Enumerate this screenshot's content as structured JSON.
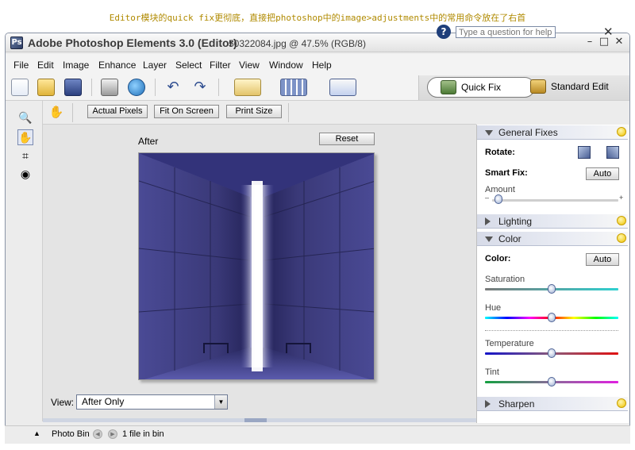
{
  "caption": "Editor模块的quick fix更彻底，直接把photoshop中的image>adjustments中的常用命令放在了右首",
  "window": {
    "title_app": "Adobe Photoshop Elements 3.0 (Editor)",
    "title_file": "50322084.jpg @ 47.5% (RGB/8)",
    "controls": [
      "–",
      "□",
      "✕"
    ]
  },
  "menu": {
    "items": [
      "File",
      "Edit",
      "Image",
      "Enhance",
      "Layer",
      "Select",
      "Filter",
      "View",
      "Window",
      "Help"
    ],
    "help_placeholder": "Type a question for help",
    "help_icon": "?",
    "close_doc": "✕"
  },
  "modes": {
    "quick_fix": "Quick Fix",
    "standard_edit": "Standard Edit"
  },
  "options_bar": {
    "actual_pixels": "Actual Pixels",
    "fit_on_screen": "Fit On Screen",
    "print_size": "Print Size"
  },
  "canvas": {
    "after_label": "After",
    "reset_label": "Reset",
    "view_label": "View:",
    "view_value": "After Only"
  },
  "palette": {
    "general_fixes": {
      "title": "General Fixes",
      "rotate_label": "Rotate:",
      "smart_fix_label": "Smart Fix:",
      "auto_label": "Auto",
      "amount_label": "Amount",
      "amount_level": 0.05
    },
    "lighting": {
      "title": "Lighting"
    },
    "color": {
      "title": "Color",
      "color_label": "Color:",
      "auto_label": "Auto",
      "saturation_label": "Saturation",
      "saturation_level": 0.5,
      "hue_label": "Hue",
      "hue_level": 0.5,
      "temperature_label": "Temperature",
      "temperature_level": 0.5,
      "tint_label": "Tint",
      "tint_level": 0.5
    },
    "sharpen": {
      "title": "Sharpen"
    }
  },
  "status": {
    "photo_bin_label": "Photo Bin",
    "bin_count": "1 file in bin"
  },
  "colors": {
    "accent": "#1f3f7a",
    "photo_blue": "#3d3c88"
  }
}
